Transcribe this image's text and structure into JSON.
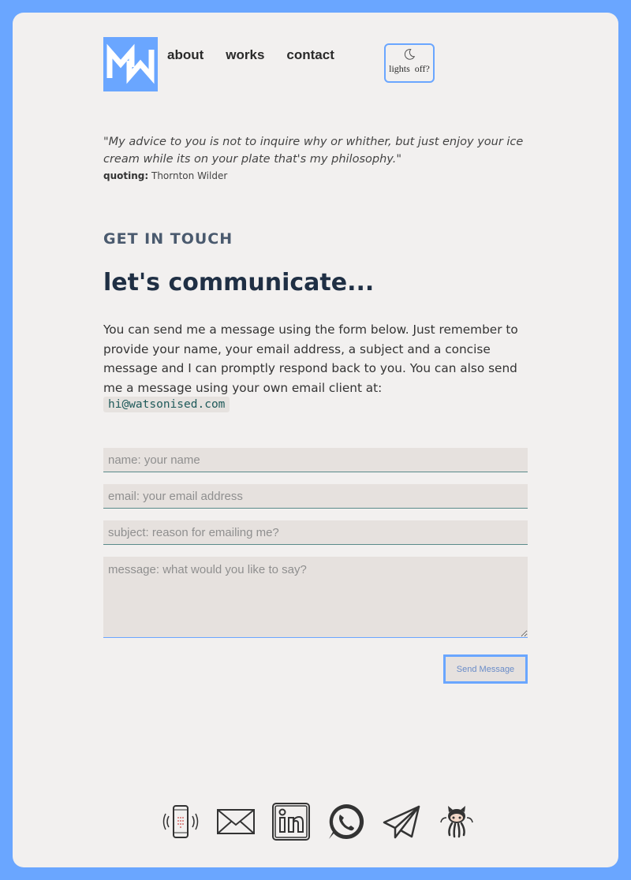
{
  "nav": {
    "about": "about",
    "works": "works",
    "contact": "contact"
  },
  "lights_label": "lights off?",
  "quote": {
    "text": "\"My advice to you is not to inquire why or whither, but just enjoy your ice cream while its on your plate that's my philosophy.\"",
    "quoting_label": "quoting:",
    "author": "Thornton Wilder"
  },
  "contact": {
    "eyebrow": "GET IN TOUCH",
    "title": "let's communicate...",
    "paragraph": "You can send me a message using the form below. Just remember to provide your name, your email address, a subject and a concise message and I can promptly respond back to you. You can also send me a message using your own email client at:",
    "email": "hi@watsonised.com"
  },
  "form": {
    "name_placeholder": "name: your name",
    "email_placeholder": "email: your email address",
    "subject_placeholder": "subject: reason for emailing me?",
    "message_placeholder": "message: what would you like to say?",
    "send_label": "Send Message"
  },
  "social_icons": [
    "phone-icon",
    "mail-icon",
    "linkedin-icon",
    "whatsapp-icon",
    "telegram-icon",
    "github-icon"
  ],
  "colors": {
    "accent": "#6aa6ff",
    "background": "#f2f0ef",
    "heading": "#1f2f44"
  }
}
